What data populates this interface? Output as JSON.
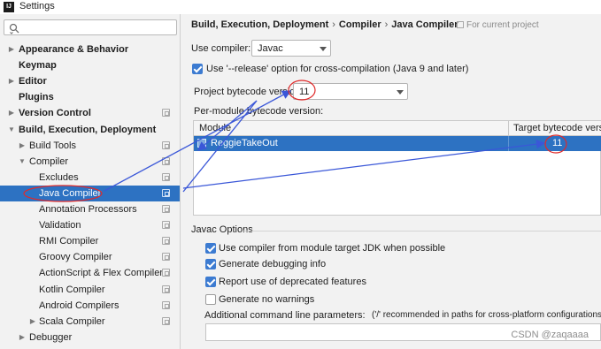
{
  "window": {
    "title": "Settings",
    "app_icon_text": "IJ"
  },
  "search": {
    "placeholder": ""
  },
  "sidebar": {
    "items": [
      {
        "label": "Appearance & Behavior",
        "bold": true,
        "arrow": "▶",
        "indent": 0,
        "project_icon": false
      },
      {
        "label": "Keymap",
        "bold": true,
        "arrow": "",
        "indent": 0,
        "project_icon": false
      },
      {
        "label": "Editor",
        "bold": true,
        "arrow": "▶",
        "indent": 0,
        "project_icon": false
      },
      {
        "label": "Plugins",
        "bold": true,
        "arrow": "",
        "indent": 0,
        "project_icon": false
      },
      {
        "label": "Version Control",
        "bold": true,
        "arrow": "▶",
        "indent": 0,
        "project_icon": true
      },
      {
        "label": "Build, Execution, Deployment",
        "bold": true,
        "arrow": "▼",
        "indent": 0,
        "project_icon": false
      },
      {
        "label": "Build Tools",
        "bold": false,
        "arrow": "▶",
        "indent": 1,
        "project_icon": true
      },
      {
        "label": "Compiler",
        "bold": false,
        "arrow": "▼",
        "indent": 1,
        "project_icon": true
      },
      {
        "label": "Excludes",
        "bold": false,
        "arrow": "",
        "indent": 2,
        "project_icon": true
      },
      {
        "label": "Java Compiler",
        "bold": false,
        "arrow": "",
        "indent": 2,
        "project_icon": true,
        "selected": true
      },
      {
        "label": "Annotation Processors",
        "bold": false,
        "arrow": "",
        "indent": 2,
        "project_icon": true
      },
      {
        "label": "Validation",
        "bold": false,
        "arrow": "",
        "indent": 2,
        "project_icon": true
      },
      {
        "label": "RMI Compiler",
        "bold": false,
        "arrow": "",
        "indent": 2,
        "project_icon": true
      },
      {
        "label": "Groovy Compiler",
        "bold": false,
        "arrow": "",
        "indent": 2,
        "project_icon": true
      },
      {
        "label": "ActionScript & Flex Compiler",
        "bold": false,
        "arrow": "",
        "indent": 2,
        "project_icon": true
      },
      {
        "label": "Kotlin Compiler",
        "bold": false,
        "arrow": "",
        "indent": 2,
        "project_icon": true
      },
      {
        "label": "Android Compilers",
        "bold": false,
        "arrow": "",
        "indent": 2,
        "project_icon": true
      },
      {
        "label": "Scala Compiler",
        "bold": false,
        "arrow": "▶",
        "indent": 2,
        "project_icon": true
      },
      {
        "label": "Debugger",
        "bold": false,
        "arrow": "▶",
        "indent": 1,
        "project_icon": false
      }
    ]
  },
  "breadcrumb": {
    "part1": "Build, Execution, Deployment",
    "sep": "›",
    "part2": "Compiler",
    "part3": "Java Compiler"
  },
  "for_current_project": "For current project",
  "use_compiler": {
    "label": "Use compiler:",
    "value": "Javac"
  },
  "release_option": {
    "label": "Use '--release' option for cross-compilation (Java 9 and later)",
    "checked": true
  },
  "bytecode": {
    "label": "Project bytecode version:",
    "value": "11"
  },
  "per_module_label": "Per-module bytecode version:",
  "table": {
    "headers": [
      "Module",
      "Target bytecode version"
    ],
    "rows": [
      {
        "module": "ReggieTakeOut",
        "target": "11"
      }
    ]
  },
  "javac_options": {
    "title": "Javac Options",
    "checks": [
      {
        "label": "Use compiler from module target JDK when possible",
        "checked": true
      },
      {
        "label": "Generate debugging info",
        "checked": true
      },
      {
        "label": "Report use of deprecated features",
        "checked": true
      },
      {
        "label": "Generate no warnings",
        "checked": false
      }
    ],
    "params_label": "Additional command line parameters:",
    "params_hint": "('/' recommended in paths for cross-platform configurations)",
    "params_value": ""
  },
  "watermark": "CSDN @zaqaaaa",
  "colors": {
    "selection": "#2d72c2",
    "checkbox": "#3c7bd1",
    "annotation": "#3a57d8",
    "highlight_circle": "#e02a2a"
  }
}
